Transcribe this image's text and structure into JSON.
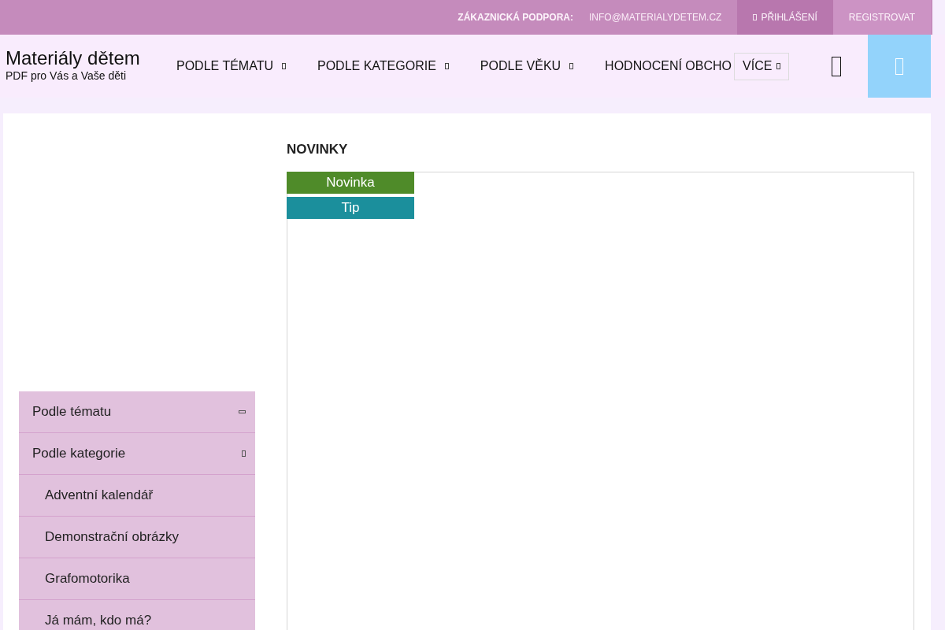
{
  "top_bar": {
    "support_label": "ZÁKAZNICKÁ PODPORA:",
    "email": "INFO@MATERIALYDETEM.CZ",
    "buttons": [
      {
        "label": "PŘIHLÁŠENÍ",
        "kind": "login",
        "highlighted": true
      },
      {
        "label": "REGISTROVAT",
        "kind": "register",
        "highlighted": false
      }
    ]
  },
  "header": {
    "logo_title": "Materiály dětem",
    "logo_subtitle": "PDF pro Vás a Vaše děti",
    "nav": [
      {
        "label": "PODLE TÉMATU",
        "dropdown": true
      },
      {
        "label": "PODLE KATEGORIE",
        "dropdown": true
      },
      {
        "label": "PODLE VĚKU",
        "dropdown": true
      },
      {
        "label": "HODNOCENÍ OBCHO",
        "dropdown": false
      }
    ],
    "more_button": {
      "label": "VÍCE"
    }
  },
  "sidebar": {
    "items": [
      {
        "label": "Podle tématu",
        "expanded": false
      },
      {
        "label": "Podle kategorie",
        "expanded": true,
        "children": [
          {
            "label": "Adventní kalendář"
          },
          {
            "label": "Demonstrační obrázky"
          },
          {
            "label": "Grafomotorika"
          },
          {
            "label": "Já mám, kdo má?"
          }
        ]
      }
    ]
  },
  "main": {
    "title": "NOVINKY",
    "badges": [
      {
        "label": "Novinka",
        "color": "#4f8b29"
      },
      {
        "label": "Tip",
        "color": "#1b8f9c"
      }
    ]
  }
}
